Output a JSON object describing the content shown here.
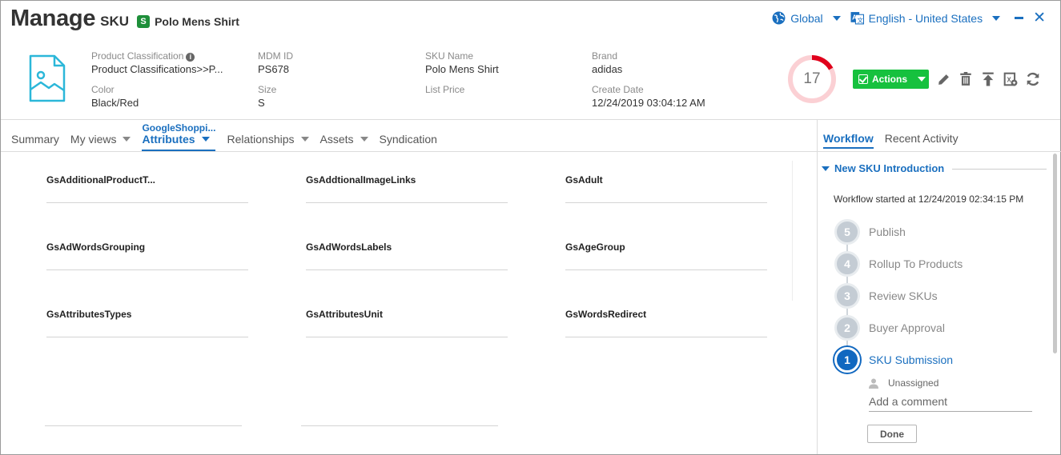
{
  "header": {
    "title": "Manage",
    "entity_type": "SKU",
    "entity_badge": "S",
    "entity_name": "Polo Mens Shirt",
    "scope_label": "Global",
    "locale_label": "English - United States"
  },
  "summary": {
    "product_classification_label": "Product Classification",
    "product_classification_value": "Product Classifications>>P...",
    "mdm_id_label": "MDM ID",
    "mdm_id_value": "PS678",
    "sku_name_label": "SKU Name",
    "sku_name_value": "Polo Mens Shirt",
    "brand_label": "Brand",
    "brand_value": "adidas",
    "color_label": "Color",
    "color_value": "Black/Red",
    "size_label": "Size",
    "size_value": "S",
    "list_price_label": "List Price",
    "list_price_value": "",
    "create_date_label": "Create Date",
    "create_date_value": "12/24/2019 03:04:12 AM"
  },
  "score": {
    "value": "17",
    "fraction": 0.17,
    "color": "#e0001b",
    "track_color": "#fbd0d4"
  },
  "toolbar": {
    "actions_label": "Actions",
    "accent": "#16c13e"
  },
  "tabs": {
    "summary": "Summary",
    "my_views": "My views",
    "attributes_sup": "GoogleShoppi...",
    "attributes": "Attributes",
    "relationships": "Relationships",
    "assets": "Assets",
    "syndication": "Syndication"
  },
  "fields": [
    {
      "label": "GsAdditionalProductT..."
    },
    {
      "label": "GsAddtionalImageLinks"
    },
    {
      "label": "GsAdult"
    },
    {
      "label": "GsAdWordsGrouping"
    },
    {
      "label": "GsAdWordsLabels"
    },
    {
      "label": "GsAgeGroup"
    },
    {
      "label": "GsAttributesTypes"
    },
    {
      "label": "GsAttributesUnit"
    },
    {
      "label": "GsWordsRedirect"
    }
  ],
  "panel": {
    "tab_workflow": "Workflow",
    "tab_recent": "Recent Activity",
    "workflow_name": "New SKU Introduction",
    "workflow_started": "Workflow started at 12/24/2019 02:34:15 PM",
    "steps": [
      {
        "num": "5",
        "label": "Publish"
      },
      {
        "num": "4",
        "label": "Rollup To Products"
      },
      {
        "num": "3",
        "label": "Review SKUs"
      },
      {
        "num": "2",
        "label": "Buyer Approval"
      },
      {
        "num": "1",
        "label": "SKU Submission"
      }
    ],
    "assignee": "Unassigned",
    "comment_placeholder": "Add a comment",
    "done_label": "Done"
  },
  "colors": {
    "link_blue": "#1a6fbf",
    "current_step": "#1168c0"
  }
}
